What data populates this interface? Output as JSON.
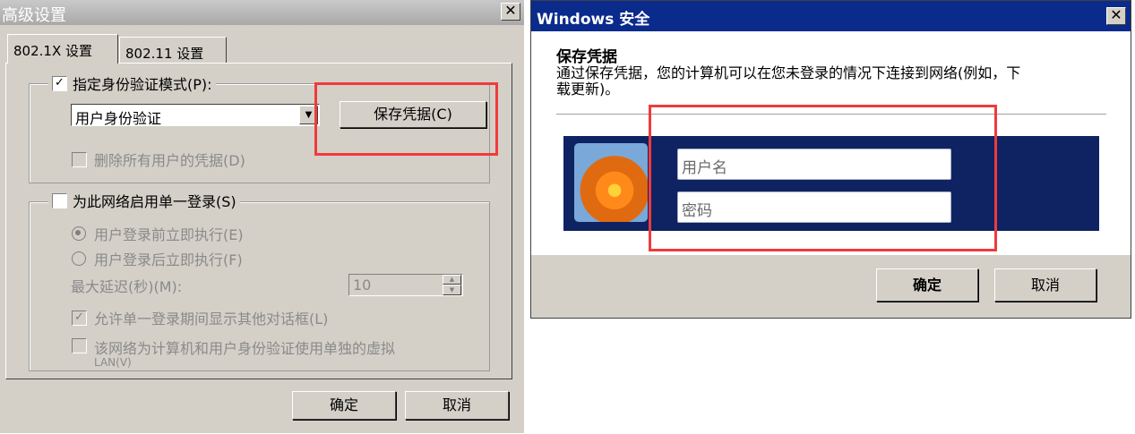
{
  "left_dialog": {
    "title": "高级设置",
    "close_glyph": "✕",
    "tabs": [
      "802.1X 设置",
      "802.11 设置"
    ],
    "auth_group": {
      "checkbox_label": "指定身份验证模式(P):",
      "checkbox_checked": true,
      "mode_value": "用户身份验证",
      "save_credentials_button": "保存凭据(C)",
      "delete_creds_label": "删除所有用户的凭据(D)"
    },
    "sso_group": {
      "checkbox_label": "为此网络启用单一登录(S)",
      "radio_before": "用户登录前立即执行(E)",
      "radio_after": "用户登录后立即执行(F)",
      "delay_label": "最大延迟(秒)(M):",
      "delay_value": "10",
      "allow_dialogs_label": "允许单一登录期间显示其他对话框(L)",
      "vlan_label_line1": "该网络为计算机和用户身份验证使用单独的虚拟",
      "vlan_label_line2": "LAN(V)"
    },
    "ok_button": "确定",
    "cancel_button": "取消",
    "highlight_color": "#ef3b3b"
  },
  "right_dialog": {
    "title": "Windows 安全",
    "close_glyph": "✕",
    "heading": "保存凭据",
    "description_line1": "通过保存凭据，您的计算机可以在您未登录的情况下连接到网络(例如，下",
    "description_line2": "载更新)。",
    "username_placeholder": "用户名",
    "password_placeholder": "密码",
    "ok_button": "确定",
    "cancel_button": "取消",
    "banner_color": "#0f2363"
  }
}
